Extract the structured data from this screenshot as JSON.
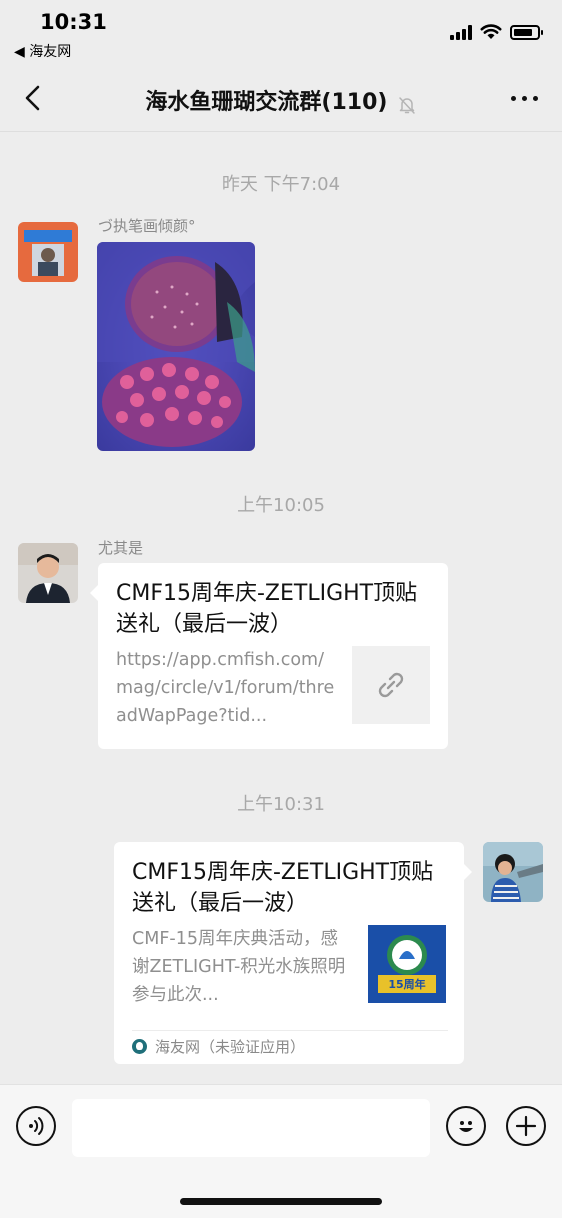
{
  "status_bar": {
    "time": "10:31",
    "back_app": "◀ 海友网",
    "battery_level": 0.8
  },
  "nav": {
    "title": "海水鱼珊瑚交流群(110)",
    "muted_icon": "bell-slash-icon",
    "more_icon": "more-icon"
  },
  "messages": {
    "ts1": "昨天 下午7:04",
    "sender1": "づ执笔画倾颜°",
    "ts2": "上午10:05",
    "sender2": "尤其是",
    "card1": {
      "title": "CMF15周年庆-ZETLIGHT顶贴送礼（最后一波）",
      "url": "https://app.cmfish.com/mag/circle/v1/forum/threadWapPage?tid..."
    },
    "ts3": "上午10:31",
    "card2": {
      "title": "CMF15周年庆-ZETLIGHT顶贴送礼（最后一波）",
      "desc": "CMF-15周年庆典活动，感谢ZETLIGHT-积光水族照明参与此次...",
      "source": "海友网（未验证应用）",
      "thumb_text": "15周年"
    }
  },
  "input_bar": {
    "voice_icon": "voice-icon",
    "emoji_icon": "emoji-icon",
    "plus_icon": "plus-icon",
    "placeholder": ""
  },
  "colors": {
    "background": "#ededed",
    "bubble": "#ffffff",
    "muted_text": "#a8a8a8"
  }
}
